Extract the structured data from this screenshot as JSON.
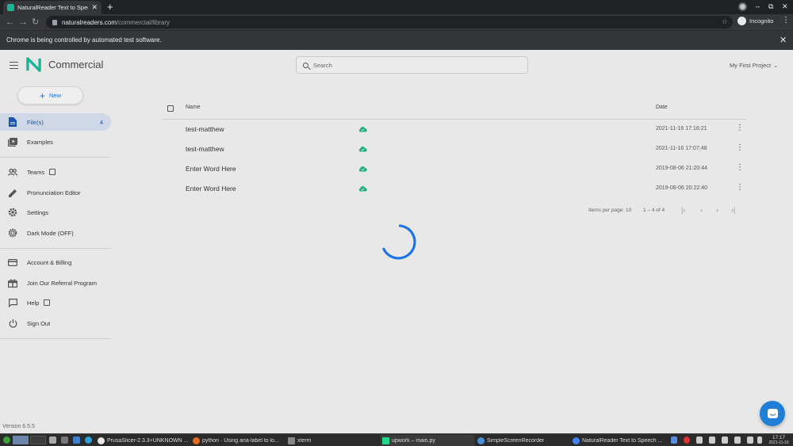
{
  "browser": {
    "tab_title": "NaturalReader Text to Speech",
    "tab_close": "✕",
    "new_tab": "+",
    "url_host": "naturalreaders.com",
    "url_path": "/commercial/library",
    "incognito_label": "Incognito",
    "automation_notice": "Chrome is being controlled by automated test software.",
    "win_minimize": "–",
    "win_restore": "⧉",
    "win_close": "✕"
  },
  "app": {
    "brand": "Commercial",
    "search_placeholder": "Search",
    "project_label": "My First Project",
    "project_chevron": "⌄",
    "accent": "#1a73e8",
    "logo_color": "#1ab394"
  },
  "sidebar": {
    "new_label": "New",
    "new_icon": "+",
    "items": [
      {
        "label": "File(s)",
        "count": "4",
        "icon": "file-icon"
      },
      {
        "label": "Examples",
        "icon": "play-library-icon"
      },
      {
        "label": "Teams",
        "icon": "people-icon"
      },
      {
        "label": "Pronunciation Editor",
        "icon": "pencil-icon"
      },
      {
        "label": "Settings",
        "icon": "gear-icon"
      },
      {
        "label": "Dark Mode (OFF)",
        "icon": "brightness-icon"
      },
      {
        "label": "Account & Billing",
        "icon": "credit-card-icon"
      },
      {
        "label": "Join Our Referral Program",
        "icon": "gift-icon"
      },
      {
        "label": "Help",
        "icon": "chat-icon"
      },
      {
        "label": "Sign Out",
        "icon": "power-icon"
      }
    ]
  },
  "table": {
    "col_name": "Name",
    "col_date": "Date",
    "rows": [
      {
        "name": "test-matthew",
        "date": "2021-11-16 17:16:21"
      },
      {
        "name": "test-matthew",
        "date": "2021-11-16 17:07:48"
      },
      {
        "name": "Enter Word Here",
        "date": "2019-08-06 21:20:44"
      },
      {
        "name": "Enter Word Here",
        "date": "2019-08-06 20:22:40"
      }
    ],
    "row_menu": "⋮",
    "pager_items_per_page": "Items per page: 10",
    "pager_range": "1 – 4 of 4",
    "pager_first": "|‹",
    "pager_prev": "‹",
    "pager_next": "›",
    "pager_last": "›|",
    "cloud_color": "#1db07a"
  },
  "footer": {
    "version": "Version 6.5.5"
  },
  "taskbar": {
    "tasks": [
      {
        "label": "PrusaSlicer-2.3.3+UNKNOWN ..."
      },
      {
        "label": "python · Using aria-label to lo..."
      },
      {
        "label": "xterm"
      },
      {
        "label": "upwork – main.py"
      },
      {
        "label": "SimpleScreenRecorder"
      },
      {
        "label": "NaturalReader Text to Speech ..."
      }
    ],
    "time": "17:17",
    "date": "2021-11-16"
  }
}
